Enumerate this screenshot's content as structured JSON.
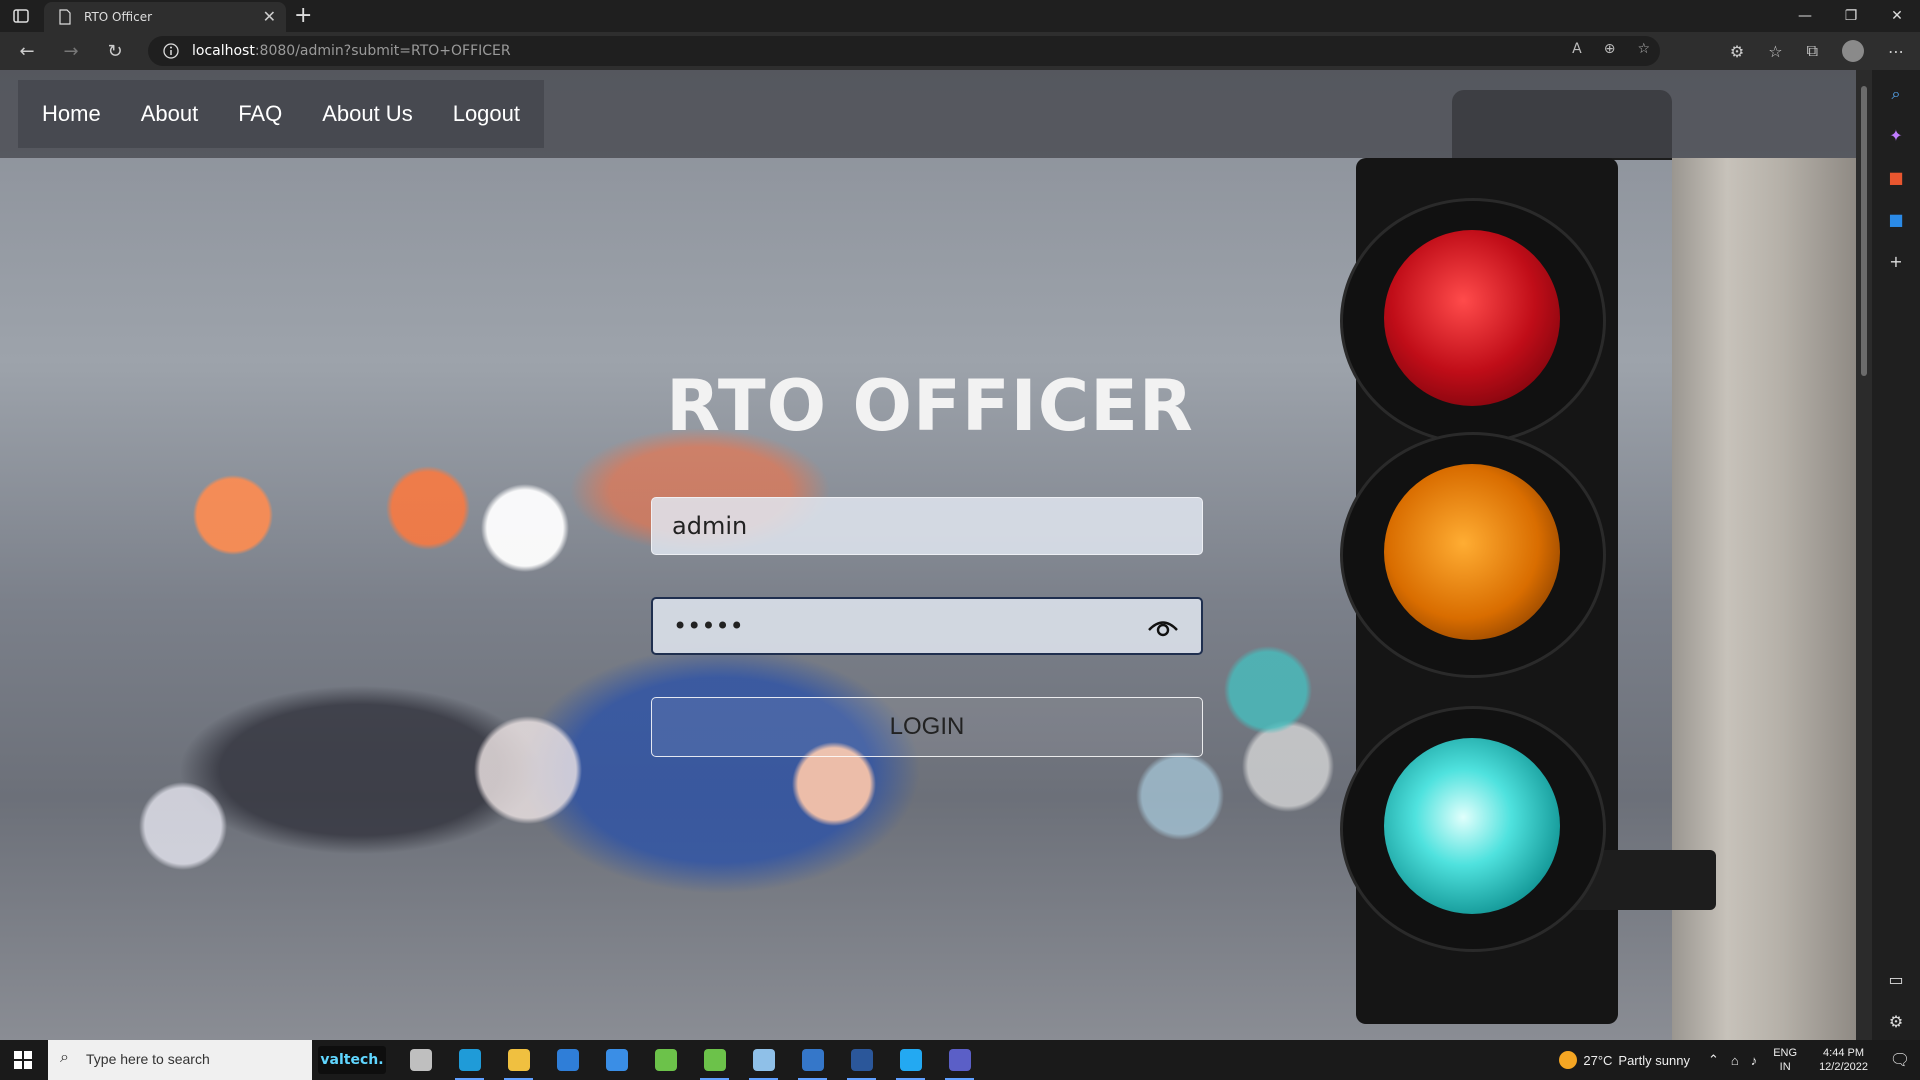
{
  "browser": {
    "tab_title": "RTO Officer",
    "tab_close": "✕",
    "new_tab": "+",
    "url_host": "localhost",
    "url_rest": ":8080/admin?submit=RTO+OFFICER",
    "window_controls": [
      "—",
      "❐",
      "✕"
    ],
    "url_tools": [
      "A",
      "⊕",
      "☆"
    ],
    "toolbar_right": [
      "⚙",
      "☆",
      "⧉"
    ]
  },
  "nav": {
    "items": [
      {
        "label": "Home"
      },
      {
        "label": "About"
      },
      {
        "label": "FAQ"
      },
      {
        "label": "About Us"
      },
      {
        "label": "Logout"
      }
    ]
  },
  "login": {
    "title": "RTO OFFICER",
    "username_value": "admin",
    "password_value": "•••••",
    "button_label": "LOGIN"
  },
  "taskbar": {
    "search_placeholder": "Type here to search",
    "valtech_label": "valtech.",
    "weather_temp": "27°C",
    "weather_text": "Partly sunny",
    "lang_top": "ENG",
    "lang_bottom": "IN",
    "time": "4:44 PM",
    "date": "12/2/2022",
    "apps": [
      {
        "name": "task-view",
        "color": "#bfbfbf"
      },
      {
        "name": "edge",
        "color": "#1f9bd8"
      },
      {
        "name": "file-explorer",
        "color": "#f0c040"
      },
      {
        "name": "mail",
        "color": "#2f7ed8"
      },
      {
        "name": "store",
        "color": "#3a8ee6"
      },
      {
        "name": "spring-tool-1",
        "color": "#6cc24a"
      },
      {
        "name": "spring-tool-2",
        "color": "#6cc24a"
      },
      {
        "name": "notepad",
        "color": "#8fc0e8"
      },
      {
        "name": "photos",
        "color": "#3577c9"
      },
      {
        "name": "word",
        "color": "#2b579a"
      },
      {
        "name": "vscode",
        "color": "#23a9f2"
      },
      {
        "name": "teams",
        "color": "#5b5fc7"
      }
    ]
  }
}
